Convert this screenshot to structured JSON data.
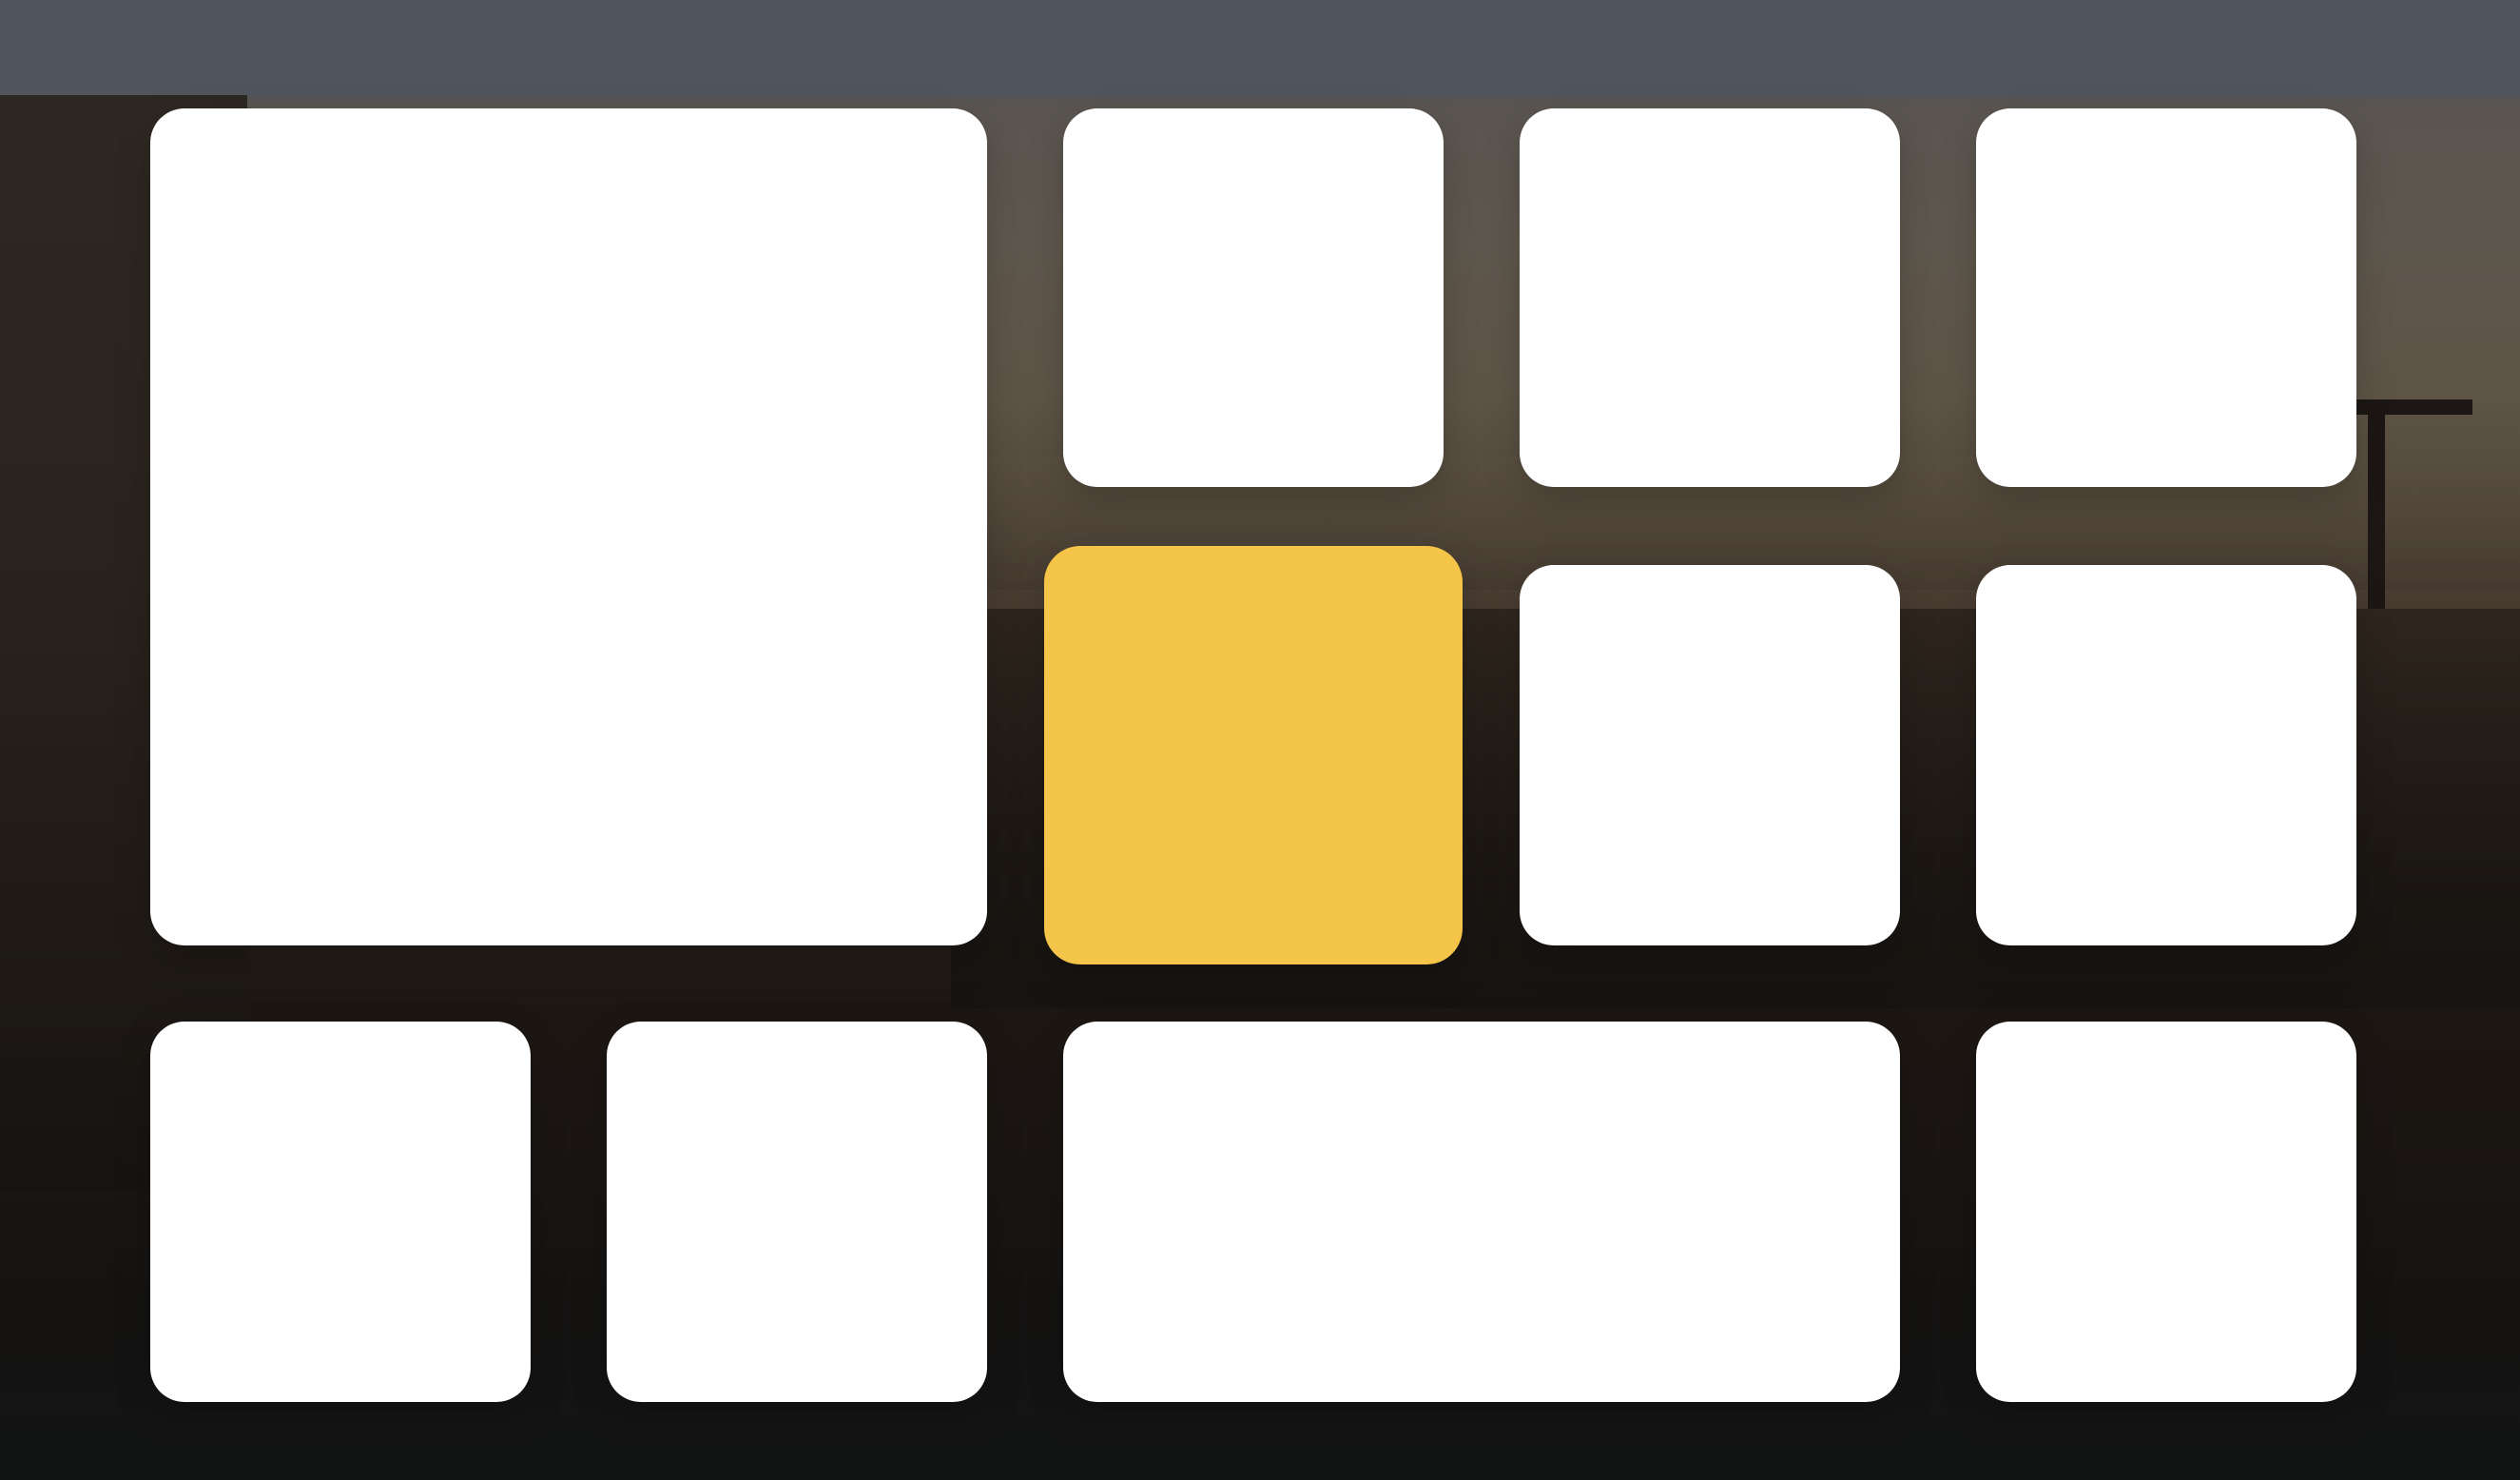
{
  "colors": {
    "tile": "#ffffff",
    "accent_tile": "#f5c54a",
    "top_bar": "#50555d"
  },
  "tiles": [
    {
      "id": "tile-large"
    },
    {
      "id": "tile-r1c3"
    },
    {
      "id": "tile-r1c4"
    },
    {
      "id": "tile-r1c5"
    },
    {
      "id": "tile-focused",
      "selected": true
    },
    {
      "id": "tile-r2c4"
    },
    {
      "id": "tile-r2c5"
    },
    {
      "id": "tile-r3c1"
    },
    {
      "id": "tile-r3c2"
    },
    {
      "id": "tile-wide"
    },
    {
      "id": "tile-r3c5"
    }
  ]
}
